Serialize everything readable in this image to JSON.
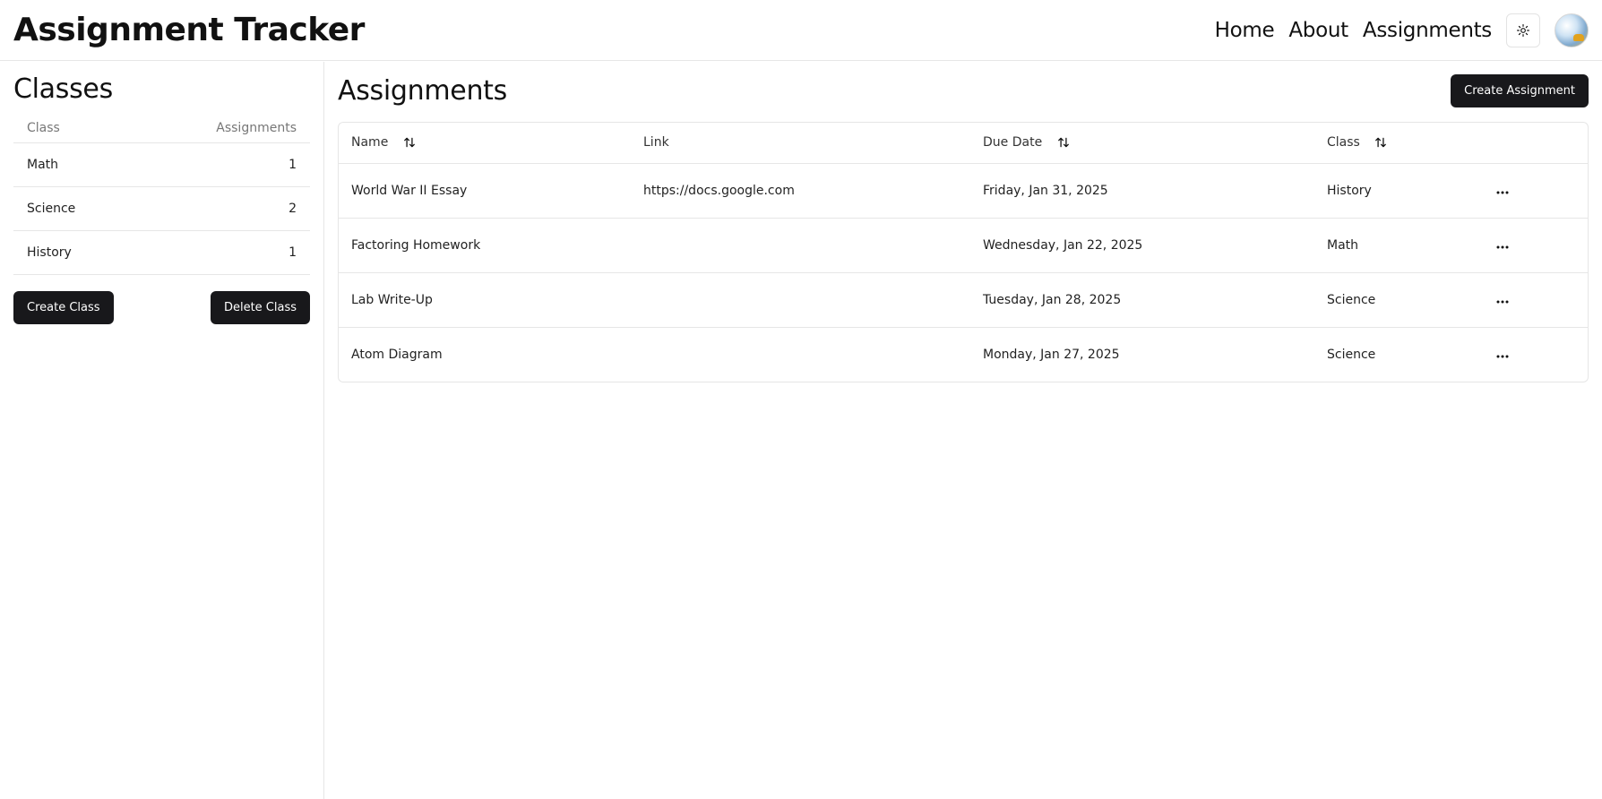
{
  "header": {
    "title": "Assignment Tracker",
    "nav": [
      "Home",
      "About",
      "Assignments"
    ],
    "theme_icon": "sun-icon",
    "avatar_icon": "user-avatar"
  },
  "sidebar": {
    "title": "Classes",
    "columns": {
      "class": "Class",
      "assignments": "Assignments"
    },
    "rows": [
      {
        "class": "Math",
        "count": "1"
      },
      {
        "class": "Science",
        "count": "2"
      },
      {
        "class": "History",
        "count": "1"
      }
    ],
    "create_label": "Create Class",
    "delete_label": "Delete Class"
  },
  "main": {
    "title": "Assignments",
    "create_label": "Create Assignment",
    "columns": {
      "name": "Name",
      "link": "Link",
      "due": "Due Date",
      "class": "Class"
    },
    "rows": [
      {
        "name": "World War II Essay",
        "link": "https://docs.google.com",
        "due": "Friday, Jan 31, 2025",
        "class": "History",
        "overdue": false
      },
      {
        "name": "Factoring Homework",
        "link": "",
        "due": "Wednesday, Jan 22, 2025",
        "class": "Math",
        "overdue": true
      },
      {
        "name": "Lab Write-Up",
        "link": "",
        "due": "Tuesday, Jan 28, 2025",
        "class": "Science",
        "overdue": false
      },
      {
        "name": "Atom Diagram",
        "link": "",
        "due": "Monday, Jan 27, 2025",
        "class": "Science",
        "overdue": false
      }
    ]
  },
  "colors": {
    "overdue": "#d9534f",
    "button_bg": "#18181b",
    "border": "#e6e6e6"
  }
}
